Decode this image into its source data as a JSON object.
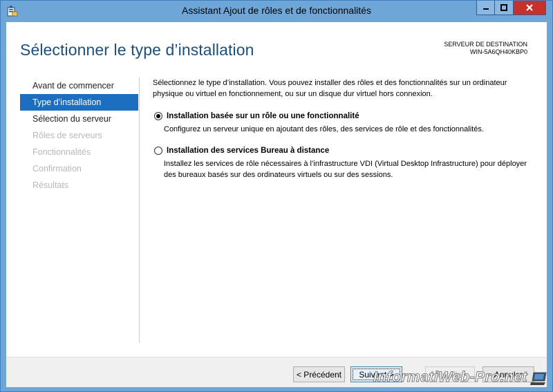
{
  "window": {
    "title": "Assistant Ajout de rôles et de fonctionnalités",
    "accent": "#6ea6d8",
    "close_color": "#c7302b"
  },
  "header": {
    "page_title": "Sélectionner le type d’installation",
    "destination_label": "SERVEUR DE DESTINATION",
    "destination_server": "WIN-5A6QH40KBP0"
  },
  "nav": {
    "items": [
      {
        "label": "Avant de commencer",
        "state": "normal"
      },
      {
        "label": "Type d’installation",
        "state": "active"
      },
      {
        "label": "Sélection du serveur",
        "state": "normal"
      },
      {
        "label": "Rôles de serveurs",
        "state": "disabled"
      },
      {
        "label": "Fonctionnalités",
        "state": "disabled"
      },
      {
        "label": "Confirmation",
        "state": "disabled"
      },
      {
        "label": "Résultats",
        "state": "disabled"
      }
    ],
    "active_color": "#1c6ec0"
  },
  "content": {
    "intro": "Sélectionnez le type d’installation. Vous pouvez installer des rôles et des fonctionnalités sur un ordinateur physique ou virtuel en fonctionnement, ou sur un disque dur virtuel hors connexion.",
    "options": [
      {
        "label": "Installation basée sur un rôle ou une fonctionnalité",
        "description": "Configurez un serveur unique en ajoutant des rôles, des services de rôle et des fonctionnalités.",
        "selected": true
      },
      {
        "label": "Installation des services Bureau à distance",
        "description": "Installez les services de rôle nécessaires à l’infrastructure VDI (Virtual Desktop Infrastructure) pour déployer des bureaux basés sur des ordinateurs virtuels ou sur des sessions.",
        "selected": false
      }
    ]
  },
  "footer": {
    "previous_label": "< Précédent",
    "next_label": "Suivant >",
    "install_label": "Installer",
    "cancel_label": "Annuler"
  },
  "watermark": {
    "text": "InformatiWeb-Pro.net"
  }
}
